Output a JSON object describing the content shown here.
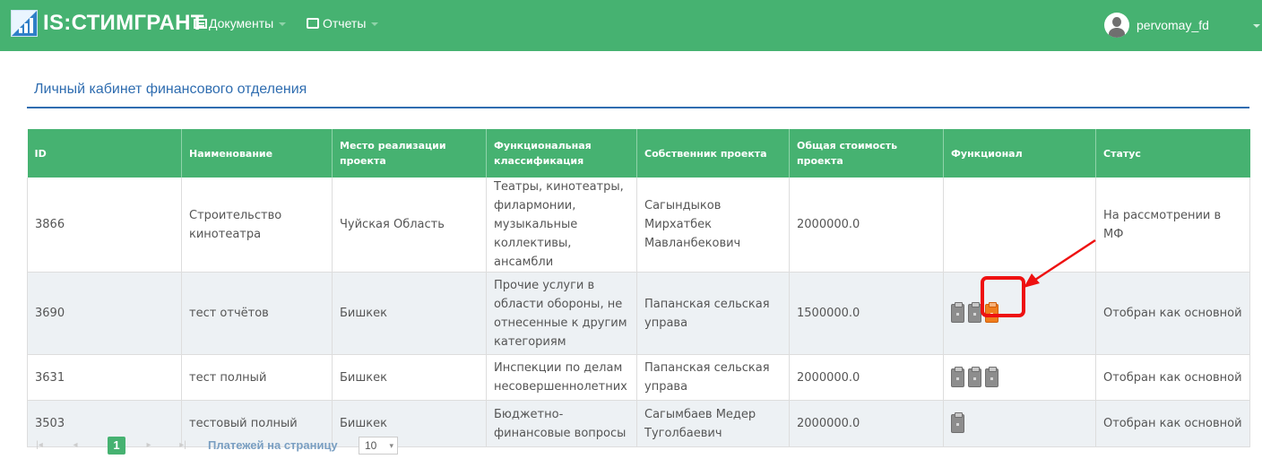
{
  "app": {
    "brand": "IS:СТИМГРАНТ",
    "menu": [
      {
        "label": "Документы",
        "icon": "documents-icon"
      },
      {
        "label": "Отчеты",
        "icon": "print-icon"
      }
    ],
    "user": {
      "name": "pervomay_fd",
      "icon": "user-avatar-icon"
    }
  },
  "page": {
    "title": "Личный кабинет финансового отделения"
  },
  "table": {
    "columns": [
      "ID",
      "Наименование",
      "Место реализации проекта",
      "Функциональная классификация",
      "Собственник проекта",
      "Общая стоимость проекта",
      "Функционал",
      "Статус"
    ],
    "rows": [
      {
        "id": "3866",
        "name": "Строительство кинотеатра",
        "place": "Чуйская Область",
        "classification": "Театры, кинотеатры, филармонии, музыкальные коллективы, ансамбли",
        "owner": "Сагындыков Мирхатбек Мавланбекович",
        "cost": "2000000.0",
        "functions": [],
        "status": "На рассмотрении в МФ"
      },
      {
        "id": "3690",
        "name": "тест отчётов",
        "place": "Бишкек",
        "classification": "Прочие услуги в области обороны, не отнесенные к другим категориям",
        "owner": "Папанская сельская управа",
        "cost": "1500000.0",
        "functions": [
          "gray",
          "gray",
          "orange"
        ],
        "status": "Отобран как основной"
      },
      {
        "id": "3631",
        "name": "тест полный",
        "place": "Бишкек",
        "classification": "Инспекции по делам несовершеннолетних",
        "owner": "Папанская сельская управа",
        "cost": "2000000.0",
        "functions": [
          "gray",
          "gray",
          "gray"
        ],
        "status": "Отобран как основной"
      },
      {
        "id": "3503",
        "name": "тестовый полный",
        "place": "Бишкек",
        "classification": "Бюджетно-финансовые вопросы",
        "owner": "Сагымбаев Медер Туголбаевич",
        "cost": "2000000.0",
        "functions": [
          "gray"
        ],
        "status": "Отобран как основной"
      }
    ]
  },
  "pager": {
    "first": "|◂",
    "prev": "◂",
    "current_page": "1",
    "next": "▸",
    "last": "▸|",
    "per_page_label": "Платежей на страницу",
    "per_page_value": "10",
    "dropdown_icon": "▾"
  },
  "colors": {
    "brand_green": "#46b271",
    "title_blue": "#2f6db0",
    "highlight_red": "#ee1111",
    "action_orange": "#f07d1c",
    "action_gray": "#8d8d8d"
  }
}
